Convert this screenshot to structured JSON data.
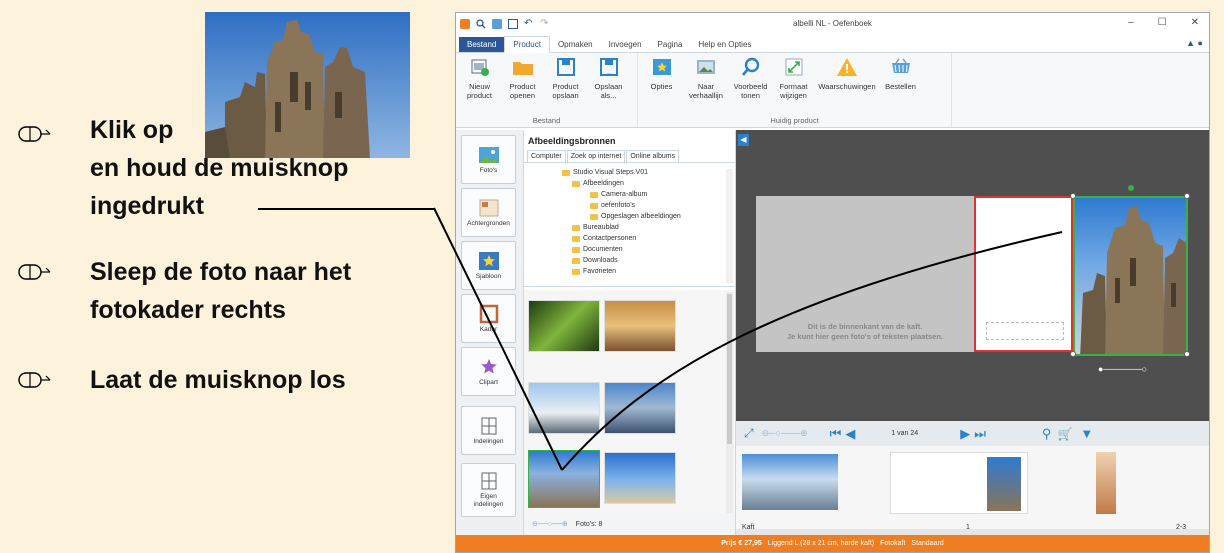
{
  "instructions": {
    "step1_line1": "Klik op",
    "step1_line2": "en houd de muisknop",
    "step1_line3": "ingedrukt",
    "step2_line1": "Sleep de foto naar het",
    "step2_line2": "fotokader rechts",
    "step3": "Laat de muisknop los"
  },
  "app": {
    "title": "albelli NL - Oefenboek",
    "window_controls": [
      "–",
      "☐",
      "✕"
    ]
  },
  "tabs": [
    "Bestand",
    "Product",
    "Opmaken",
    "Invoegen",
    "Pagina",
    "Help en Opties"
  ],
  "ribbon": {
    "group1_label": "Bestand",
    "group2_label": "Huidig product",
    "buttons": [
      {
        "line1": "Nieuw",
        "line2": "product"
      },
      {
        "line1": "Product",
        "line2": "openen"
      },
      {
        "line1": "Product",
        "line2": "opslaan"
      },
      {
        "line1": "Opslaan",
        "line2": "als..."
      },
      {
        "line1": "Opties",
        "line2": ""
      },
      {
        "line1": "Naar",
        "line2": "verhaallijn"
      },
      {
        "line1": "Voorbeeld",
        "line2": "tonen"
      },
      {
        "line1": "Formaat",
        "line2": "wijzigen"
      },
      {
        "line1": "Waarschuwingen",
        "line2": ""
      },
      {
        "line1": "Bestellen",
        "line2": ""
      }
    ]
  },
  "vnav": [
    {
      "line1": "Foto's",
      "line2": ""
    },
    {
      "line1": "Achtergronden",
      "line2": ""
    },
    {
      "line1": "Sjabloon",
      "line2": ""
    },
    {
      "line1": "Kader",
      "line2": ""
    },
    {
      "line1": "Clipart",
      "line2": ""
    },
    {
      "line1": "Indelingen",
      "line2": ""
    },
    {
      "line1": "Eigen",
      "line2": "indelingen"
    }
  ],
  "sources": {
    "title": "Afbeeldingsbronnen",
    "tabs": [
      "Computer",
      "Zoek op internet",
      "Online albums"
    ],
    "tree": [
      "Studio Visual Steps.V01",
      "Afbeeldingen",
      "Camera-album",
      "oefenfoto's",
      "Opgeslagen afbeeldingen",
      "Bureaublad",
      "Contactpersonen",
      "Documenten",
      "Downloads",
      "Favorieten"
    ],
    "footer": "Foto's: 8"
  },
  "canvas": {
    "note_line1": "Dit is de binnenkant van de kaft.",
    "note_line2": "Je kunt hier geen foto's of teksten plaatsen.",
    "page_indicator": "1 van 24"
  },
  "filmstrip": {
    "labels": [
      "Kaft",
      "1",
      "2-3"
    ]
  },
  "status": {
    "price": "Prijs € 27,95",
    "details": "Liggend L (28 x 21 cm, harde kaft)",
    "cover": "Fotokaft",
    "paper": "Standaard"
  },
  "colors": {
    "ribbon_accent": "#2b5797",
    "status_bar": "#ef7d22",
    "selection_green": "#36b14a",
    "selection_red": "#dd3333",
    "background": "#fdf2dc"
  }
}
